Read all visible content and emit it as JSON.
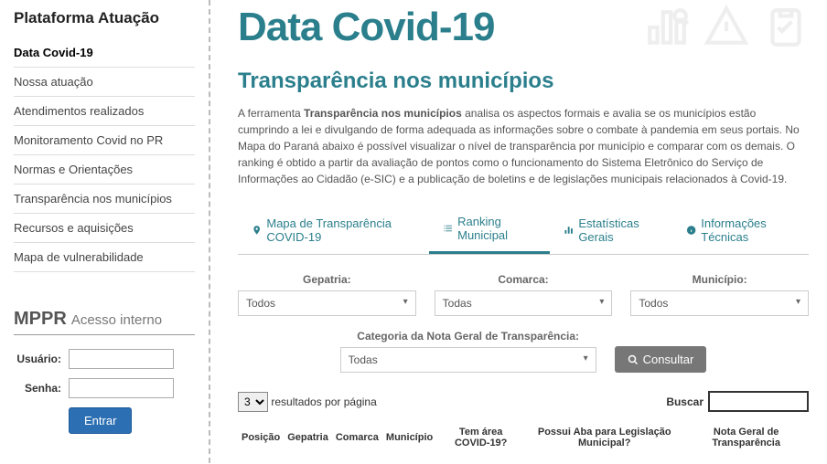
{
  "sidebar": {
    "title": "Plataforma Atuação",
    "items": [
      {
        "label": "Data Covid-19",
        "active": true
      },
      {
        "label": "Nossa atuação",
        "active": false
      },
      {
        "label": "Atendimentos realizados",
        "active": false
      },
      {
        "label": "Monitoramento Covid no PR",
        "active": false
      },
      {
        "label": "Normas e Orientações",
        "active": false
      },
      {
        "label": "Transparência nos municípios",
        "active": false
      },
      {
        "label": "Recursos e aquisições",
        "active": false
      },
      {
        "label": "Mapa de vulnerabilidade",
        "active": false
      }
    ]
  },
  "login": {
    "logo_mppr": "MPPR",
    "logo_acesso": "Acesso interno",
    "user_label": "Usuário:",
    "pass_label": "Senha:",
    "button": "Entrar"
  },
  "header": {
    "logo": "Data Covid-19"
  },
  "page": {
    "title": "Transparência nos municípios",
    "desc_pre": "A ferramenta ",
    "desc_bold": "Transparência nos municípios",
    "desc_post": " analisa os aspectos formais e avalia se os municípios estão cumprindo a lei e divulgando de forma adequada as informações sobre o combate à pandemia em seus portais. No Mapa do Paraná abaixo é possível visualizar o nível de transparência por município e comparar com os demais. O ranking é obtido a partir da avaliação de pontos como o funcionamento do Sistema Eletrônico do Serviço de Informações ao Cidadão (e-SIC) e a publicação de boletins e de legislações municipais relacionados à Covid-19."
  },
  "tabs": [
    {
      "label": "Mapa de Transparência COVID-19",
      "icon": "pin"
    },
    {
      "label": "Ranking Municipal",
      "icon": "list",
      "active": true
    },
    {
      "label": "Estatísticas Gerais",
      "icon": "chart"
    },
    {
      "label": "Informações Técnicas",
      "icon": "info"
    }
  ],
  "filters": {
    "gepatria": {
      "label": "Gepatria:",
      "value": "Todos"
    },
    "comarca": {
      "label": "Comarca:",
      "value": "Todas"
    },
    "municipio": {
      "label": "Município:",
      "value": "Todos"
    },
    "categoria": {
      "label": "Categoria da Nota Geral de Transparência:",
      "value": "Todas"
    },
    "consultar": "Consultar"
  },
  "table": {
    "per_page_value": "3",
    "per_page_label": "resultados por página",
    "search_label": "Buscar",
    "headers": [
      "Posição",
      "Gepatria",
      "Comarca",
      "Município",
      "Tem área COVID-19?",
      "Possui Aba para Legislação Municipal?",
      "Nota Geral de Transparência"
    ]
  }
}
